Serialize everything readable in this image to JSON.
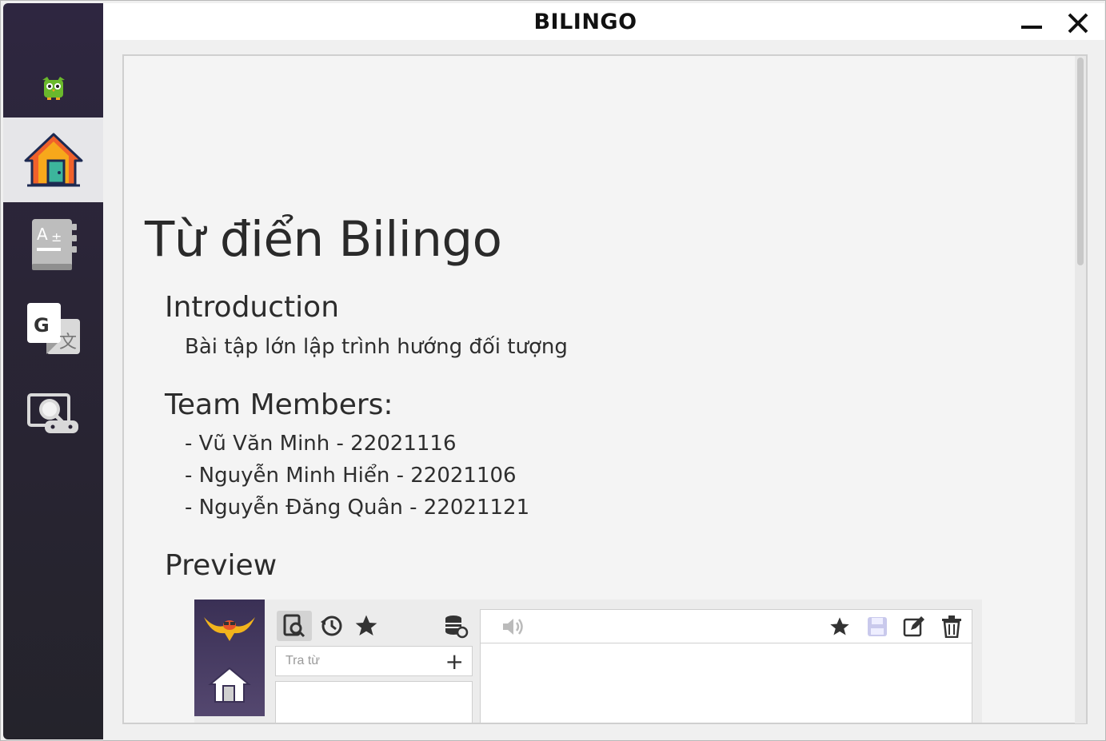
{
  "window": {
    "title": "BILINGO"
  },
  "sidebar": {
    "items": [
      {
        "name": "home",
        "icon": "home-icon",
        "active": true
      },
      {
        "name": "dictionary",
        "icon": "dictionary-book-icon",
        "active": false
      },
      {
        "name": "translate",
        "icon": "google-translate-icon",
        "active": false
      },
      {
        "name": "game",
        "icon": "game-search-icon",
        "active": false
      }
    ]
  },
  "main": {
    "heading": "Từ điển Bilingo",
    "intro_title": "Introduction",
    "intro_text": "Bài tập lớn lập trình hướng đối tượng",
    "team_title": "Team Members:",
    "members": [
      "- Vũ Văn Minh - 22021116",
      "- Nguyễn Minh Hiển - 22021106",
      "- Nguyễn Đăng Quân - 22021121"
    ],
    "preview_title": "Preview"
  },
  "preview": {
    "search_placeholder": "Tra từ",
    "add_symbol": "+"
  },
  "colors": {
    "sidebar": "#2a2536",
    "active_item": "#e6e6e9",
    "accent_purple": "#54476f"
  }
}
